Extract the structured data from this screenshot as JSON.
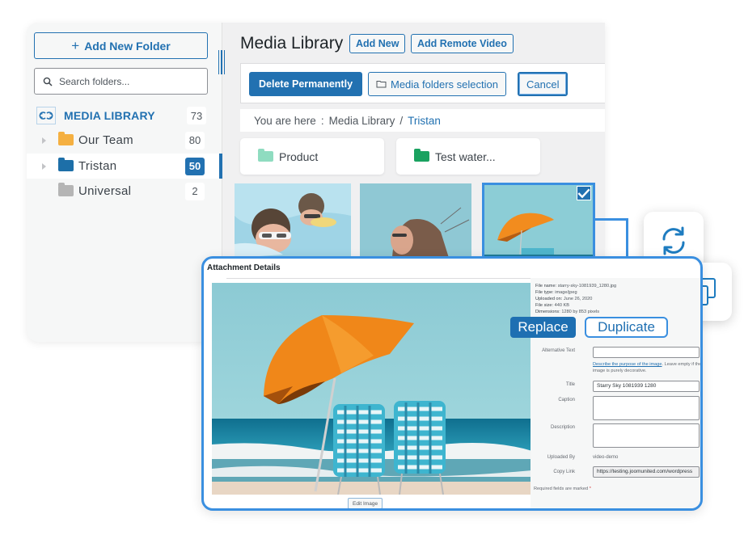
{
  "sidebar": {
    "add_folder_label": "Add New Folder",
    "search_placeholder": "Search folders...",
    "root": {
      "label": "MEDIA LIBRARY",
      "count": "73"
    },
    "folders": [
      {
        "label": "Our Team",
        "count": "80",
        "color": "#f5b041",
        "has_children": true,
        "selected": false
      },
      {
        "label": "Tristan",
        "count": "50",
        "color": "#1d6fa8",
        "has_children": true,
        "selected": true
      },
      {
        "label": "Universal",
        "count": "2",
        "color": "#b5b5b5",
        "has_children": false,
        "selected": false
      }
    ]
  },
  "header": {
    "title": "Media Library",
    "add_new_label": "Add New",
    "add_remote_video_label": "Add Remote Video"
  },
  "toolbar": {
    "delete_label": "Delete Permanently",
    "folders_selection_label": "Media folders selection",
    "cancel_label": "Cancel"
  },
  "breadcrumb": {
    "prefix": "You are here",
    "separator": ":",
    "items": [
      "Media Library",
      "Tristan"
    ],
    "divider": "/"
  },
  "subfolders": [
    {
      "label": "Product",
      "color": "#8fdcc0"
    },
    {
      "label": "Test water...",
      "color": "#1aa260"
    }
  ],
  "thumbnails": [
    {
      "subject": "kids-swimming",
      "selected": false
    },
    {
      "subject": "woman-portrait",
      "selected": false
    },
    {
      "subject": "beach-umbrella",
      "selected": true
    }
  ],
  "attachment": {
    "title": "Attachment Details",
    "edit_image_label": "Edit Image",
    "meta": {
      "filename_label": "File name:",
      "filename": "starry-sky-1081939_1280.jpg",
      "filetype_label": "File type:",
      "filetype": "image/jpeg",
      "uploaded_label": "Uploaded on:",
      "uploaded": "June 26, 2020",
      "filesize_label": "File size:",
      "filesize": "440 KB",
      "dimensions_label": "Dimensions:",
      "dimensions": "1280 by 853 pixels"
    },
    "fields": {
      "alt_label": "Alternative Text",
      "alt_value": "",
      "alt_help_link": "Describe the purpose of the image",
      "alt_help_text": ". Leave empty if the image is purely decorative.",
      "title_label": "Title",
      "title_value": "Starry Sky 1081939 1280",
      "caption_label": "Caption",
      "caption_value": "",
      "description_label": "Description",
      "description_value": "",
      "uploaded_by_label": "Uploaded By",
      "uploaded_by_value": "video-demo",
      "copy_link_label": "Copy Link",
      "copy_link_value": "https://testing.joomunited.com/wordpress",
      "required_text": "Required fields are marked",
      "required_star": "*"
    }
  },
  "actions": {
    "replace_label": "Replace",
    "duplicate_label": "Duplicate",
    "replace_icon": "refresh-icon",
    "duplicate_icon": "copy-icon"
  },
  "colors": {
    "accent": "#2271b1",
    "highlight": "#3a8fe0"
  }
}
